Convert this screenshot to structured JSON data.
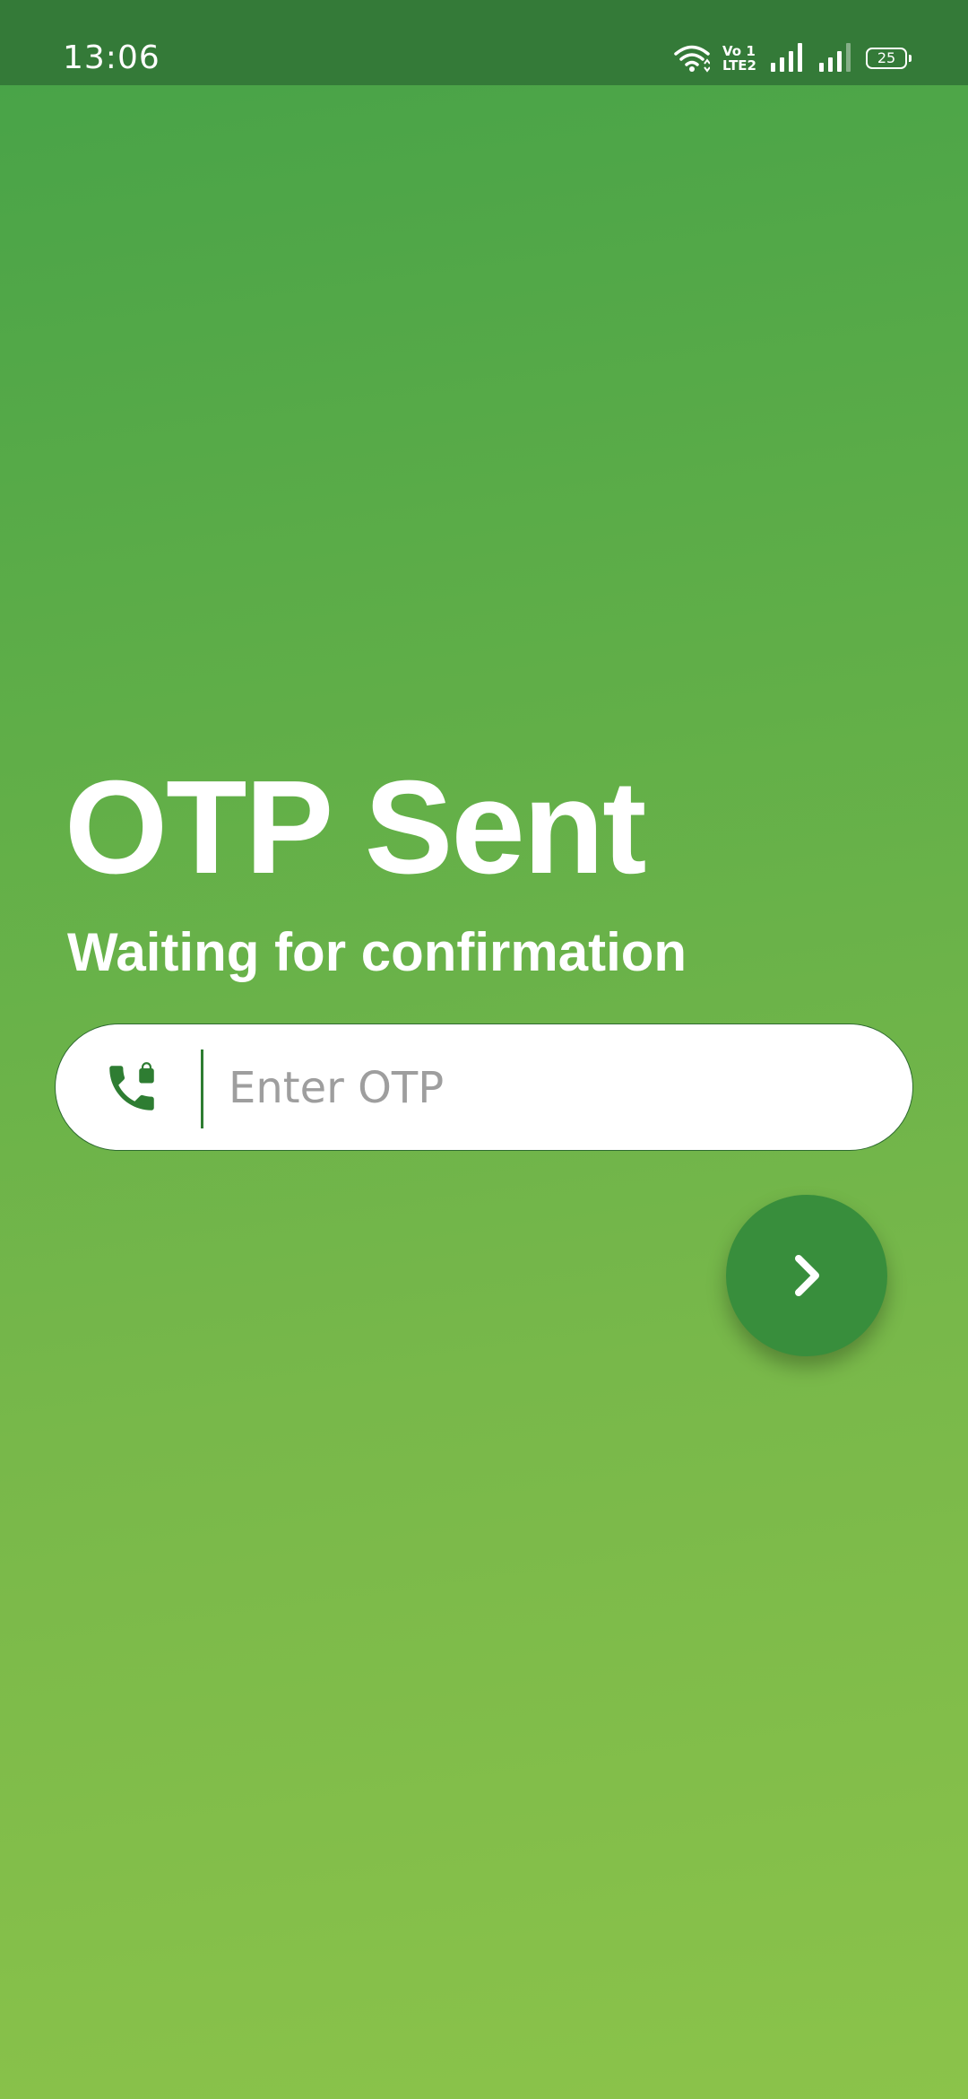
{
  "status_bar": {
    "time": "13:06",
    "volte_top": "Vo 1",
    "volte_bottom": "LTE2",
    "battery": "25",
    "icons": [
      "wifi-icon",
      "volte-icon",
      "signal-icon",
      "signal-icon",
      "battery-icon"
    ]
  },
  "header": {
    "title": "OTP Sent",
    "subtitle": "Waiting for confirmation"
  },
  "otp_field": {
    "icon": "phone-lock-icon",
    "placeholder": "Enter OTP",
    "value": ""
  },
  "next_button": {
    "icon": "chevron-right-icon"
  },
  "colors": {
    "status_bar": "#347a38",
    "gradient_top": "#46a248",
    "gradient_bottom": "#8bc34a",
    "accent": "#388e3c",
    "icon": "#2e7d32",
    "text": "#ffffff",
    "placeholder": "#9e9e9e"
  }
}
